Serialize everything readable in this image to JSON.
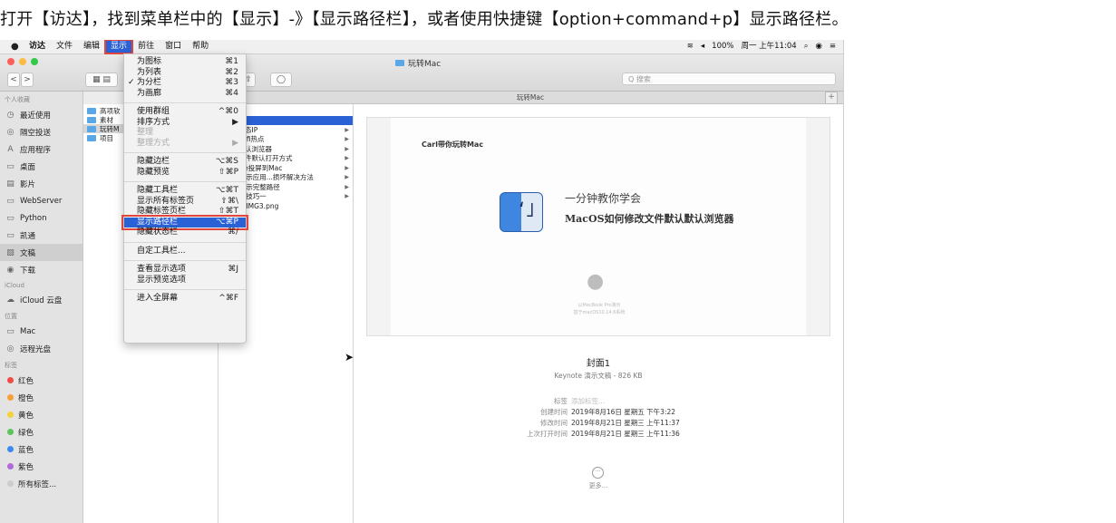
{
  "caption": "打开【访达】，找到菜单栏中的【显示】-》【显示路径栏】，或者使用快捷键【option+command+p】显示路径栏。",
  "menubar": {
    "apple": "",
    "items": [
      "访达",
      "文件",
      "编辑",
      "显示",
      "前往",
      "窗口",
      "帮助"
    ],
    "active_index": 3,
    "status": [
      "100%",
      "周一 上午11:04"
    ]
  },
  "window": {
    "title": "玩转Mac",
    "search_placeholder": "Q 搜索",
    "pathbar": "玩转Mac",
    "plus": "+"
  },
  "toolbar": {
    "back": "<",
    "forward": ">"
  },
  "colors": {
    "accent": "#2a62d6",
    "highlight_border": "#e0473a"
  },
  "sidebar": {
    "favorites_header": "个人收藏",
    "favorites": [
      {
        "icon": "recents-icon",
        "glyph": "◷",
        "label": "最近使用"
      },
      {
        "icon": "airdrop-icon",
        "glyph": "◎",
        "label": "隔空投送"
      },
      {
        "icon": "applications-icon",
        "glyph": "A",
        "label": "应用程序"
      },
      {
        "icon": "desktop-icon",
        "glyph": "▭",
        "label": "桌面"
      },
      {
        "icon": "movies-icon",
        "glyph": "▤",
        "label": "影片"
      },
      {
        "icon": "folder-icon",
        "glyph": "▭",
        "label": "WebServer"
      },
      {
        "icon": "folder-icon",
        "glyph": "▭",
        "label": "Python"
      },
      {
        "icon": "folder-icon",
        "glyph": "▭",
        "label": "凯通"
      },
      {
        "icon": "documents-icon",
        "glyph": "▧",
        "label": "文稿"
      },
      {
        "icon": "downloads-icon",
        "glyph": "◉",
        "label": "下载"
      }
    ],
    "icloud_header": "iCloud",
    "icloud": [
      {
        "icon": "cloud-icon",
        "glyph": "☁",
        "label": "iCloud 云盘"
      }
    ],
    "locations_header": "位置",
    "locations": [
      {
        "icon": "computer-icon",
        "glyph": "▭",
        "label": "Mac"
      },
      {
        "icon": "disc-icon",
        "glyph": "◎",
        "label": "远程光盘"
      }
    ],
    "tags_header": "标签",
    "tags": [
      {
        "label": "红色",
        "color": "#f14b48"
      },
      {
        "label": "橙色",
        "color": "#f5a035"
      },
      {
        "label": "黄色",
        "color": "#f3d23a"
      },
      {
        "label": "绿色",
        "color": "#5cc45a"
      },
      {
        "label": "蓝色",
        "color": "#3b8af0"
      },
      {
        "label": "紫色",
        "color": "#b26ad8"
      },
      {
        "label": "所有标签...",
        "color": "#cccccc"
      }
    ]
  },
  "column1": [
    "高项软",
    "素材",
    "玩转M",
    "项目"
  ],
  "column2": [
    {
      "label": "面",
      "arrow": false
    },
    {
      "label": "面1",
      "arrow": false,
      "selected": true
    },
    {
      "label": "置静态IP",
      "arrow": true
    },
    {
      "label": "置Wifi热点",
      "arrow": true
    },
    {
      "label": "改默认浏览器",
      "arrow": true
    },
    {
      "label": "改文件默认打开方式",
      "arrow": true
    },
    {
      "label": "hone投屏到Mac",
      "arrow": true
    },
    {
      "label": "ac提示应用...损坏解决方法",
      "arrow": true
    },
    {
      "label": "ac显示完整路径",
      "arrow": true
    },
    {
      "label": "ac小技巧一",
      "arrow": true
    },
    {
      "label": "chatIMG3.png",
      "arrow": false
    }
  ],
  "menu": {
    "items": [
      {
        "label": "为图标",
        "shortcut": "⌘1"
      },
      {
        "label": "为列表",
        "shortcut": "⌘2"
      },
      {
        "label": "为分栏",
        "shortcut": "⌘3",
        "checked": true,
        "check": "✓"
      },
      {
        "label": "为画廊",
        "shortcut": "⌘4"
      },
      {
        "sep": true
      },
      {
        "label": "使用群组",
        "shortcut": "^⌘0"
      },
      {
        "label": "排序方式",
        "shortcut": "▶"
      },
      {
        "label": "整理",
        "shortcut": "",
        "disabled": true
      },
      {
        "label": "整理方式",
        "shortcut": "▶",
        "disabled": true
      },
      {
        "sep": true
      },
      {
        "label": "隐藏边栏",
        "shortcut": "⌥⌘S"
      },
      {
        "label": "隐藏预览",
        "shortcut": "⇧⌘P"
      },
      {
        "sep": true
      },
      {
        "label": "隐藏工具栏",
        "shortcut": "⌥⌘T"
      },
      {
        "label": "显示所有标签页",
        "shortcut": "⇧⌘\\"
      },
      {
        "label": "隐藏标签页栏",
        "shortcut": "⇧⌘T"
      },
      {
        "label": "显示路径栏",
        "shortcut": "⌥⌘P",
        "highlight": true
      },
      {
        "label": "隐藏状态栏",
        "shortcut": "⌘/"
      },
      {
        "sep": true
      },
      {
        "label": "自定工具栏..."
      },
      {
        "sep": true
      },
      {
        "label": "查看显示选项",
        "shortcut": "⌘J"
      },
      {
        "label": "显示预览选项",
        "shortcut": ""
      },
      {
        "sep": true
      },
      {
        "label": "进入全屏幕",
        "shortcut": "^⌘F"
      }
    ]
  },
  "preview": {
    "slide_brand": "Carl带你玩转Mac",
    "slide_line1": "一分钟教你学会",
    "slide_line2": "MacOS如何修改文件默认默认浏览器",
    "slide_small1": "以MacBook Pro演示",
    "slide_small2": "基于macOS10.14.6系统",
    "file_title": "封面1",
    "file_sub": "Keynote 演示文稿 - 826 KB",
    "meta": [
      {
        "k": "标签",
        "v": "添加标签...",
        "placeholder": true
      },
      {
        "k": "创建时间",
        "v": "2019年8月16日 星期五 下午3:22"
      },
      {
        "k": "修改时间",
        "v": "2019年8月21日 星期三 上午11:37"
      },
      {
        "k": "上次打开时间",
        "v": "2019年8月21日 星期三 上午11:36"
      }
    ],
    "more_label": "更多..."
  }
}
